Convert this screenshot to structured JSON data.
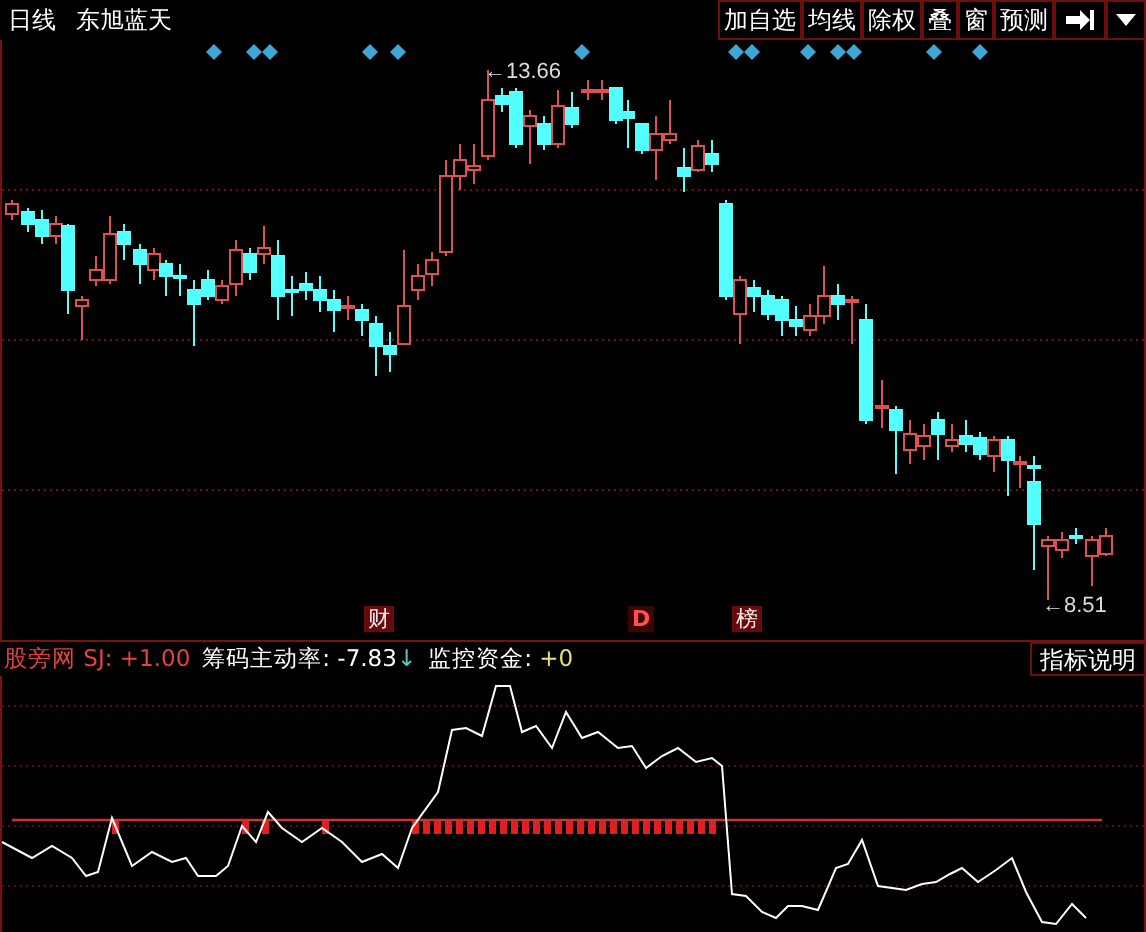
{
  "toolbar": {
    "period": "日线",
    "stock_name": "东旭蓝天",
    "buttons": [
      "加自选",
      "均线",
      "除权",
      "叠",
      "窗",
      "预测"
    ]
  },
  "chart": {
    "high_label": "←13.66",
    "low_label": "←8.51",
    "markers": [
      {
        "text": "财",
        "kind": "badge"
      },
      {
        "text": "D",
        "kind": "letter"
      },
      {
        "text": "榜",
        "kind": "badge"
      }
    ]
  },
  "indicator": {
    "readings": [
      {
        "label": "股旁网 SJ:",
        "value": "+1.00",
        "color": "#e84040",
        "kind": "title"
      },
      {
        "label": "筹码主动率:",
        "value": "-7.83",
        "color": "#ffffff",
        "kind": "field",
        "arrow": "↓"
      },
      {
        "label": "监控资金:",
        "value": "+0",
        "color": "#e8e070",
        "kind": "field"
      }
    ],
    "help_button": "指标说明"
  }
}
